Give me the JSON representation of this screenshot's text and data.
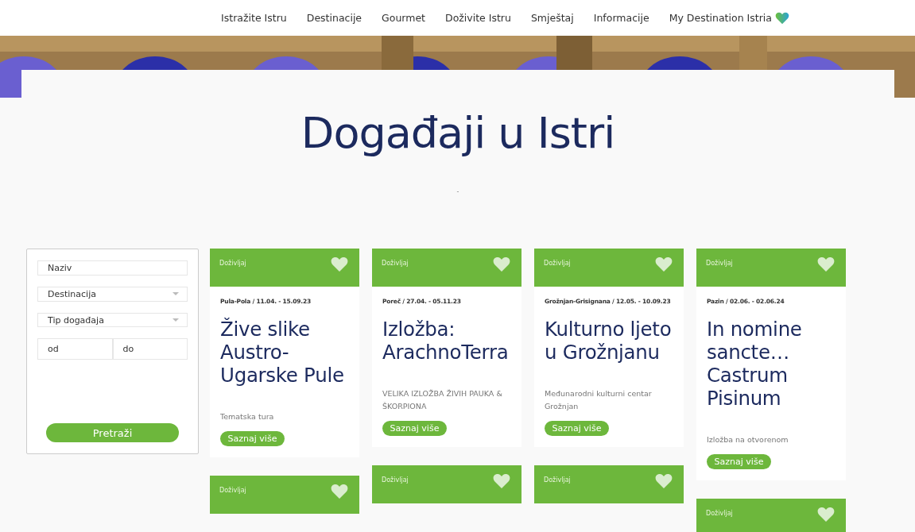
{
  "nav": {
    "items": [
      {
        "label": "Istražite Istru"
      },
      {
        "label": "Destinacije"
      },
      {
        "label": "Gourmet"
      },
      {
        "label": "Doživite Istru"
      },
      {
        "label": "Smještaj"
      },
      {
        "label": "Informacije"
      },
      {
        "label": "My Destination Istria",
        "kind": "heart"
      }
    ]
  },
  "page_title": "Događaji u Istri",
  "subtitle": "-",
  "filter": {
    "fields": [
      {
        "kind": "text",
        "placeholder": "Naziv"
      },
      {
        "kind": "select",
        "placeholder": "Destinacija"
      },
      {
        "kind": "select",
        "placeholder": "Tip događaja"
      },
      {
        "kind": "range",
        "from_placeholder": "od",
        "to_placeholder": "do"
      }
    ],
    "button": "Pretraži"
  },
  "columns": [
    [
      {
        "category": "Doživljaj",
        "place_date": "Pula-Pola / 11.04. - 15.09.23",
        "title": "Žive slike Austro-Ugarske Pule",
        "description": "Tematska tura",
        "button": "Saznaj više"
      },
      {
        "category": "Doživljaj"
      }
    ],
    [
      {
        "category": "Doživljaj",
        "place_date": "Poreč / 27.04. - 05.11.23",
        "title": "Izložba: ArachnoTerra",
        "description": "VELIKA IZLOŽBA ŽIVIH PAUKA & ŠKORPIONA",
        "button": "Saznaj više"
      },
      {
        "category": "Doživljaj"
      }
    ],
    [
      {
        "category": "Doživljaj",
        "place_date": "Grožnjan-Grisignana / 12.05. - 10.09.23",
        "title": "Kulturno ljeto u Grožnjanu",
        "description": "Međunarodni kulturni centar Grožnjan",
        "button": "Saznaj više"
      },
      {
        "category": "Doživljaj"
      }
    ],
    [
      {
        "category": "Doživljaj",
        "place_date": "Pazin / 02.06. - 02.06.24",
        "title": "In nomine sancte… Castrum Pisinum",
        "description": "Izložba na otvorenom",
        "button": "Saznaj više"
      },
      {
        "category": "Doživljaj"
      }
    ]
  ]
}
